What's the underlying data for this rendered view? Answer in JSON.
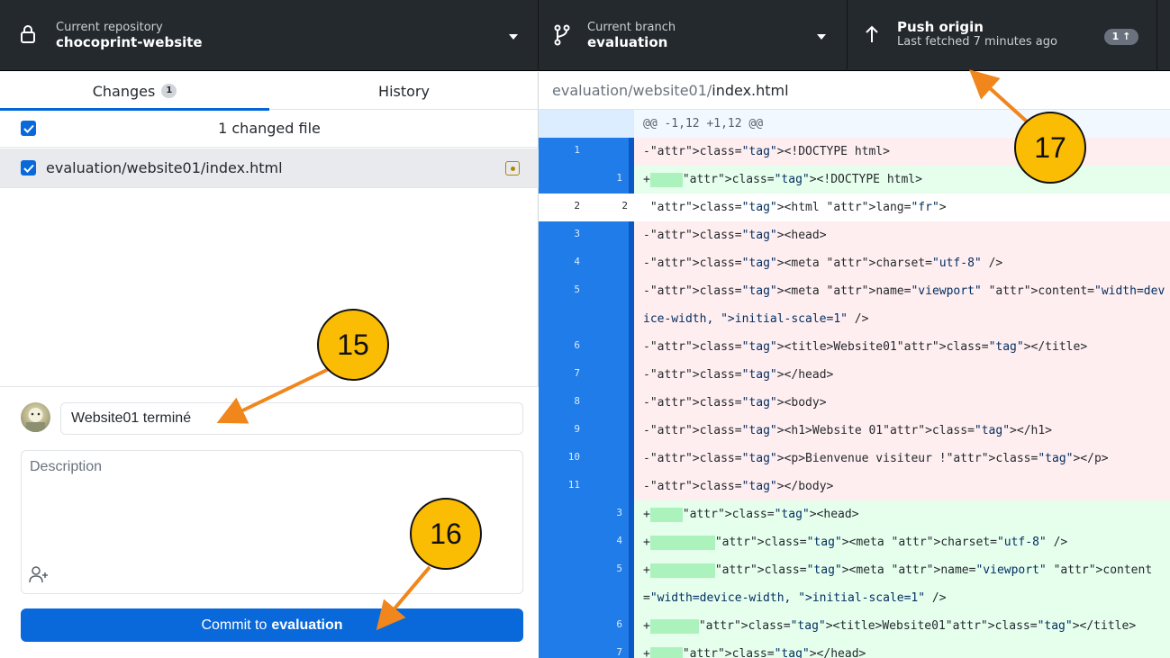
{
  "toolbar": {
    "repository": {
      "label": "Current repository",
      "value": "chocoprint-website"
    },
    "branch": {
      "label": "Current branch",
      "value": "evaluation"
    },
    "push": {
      "label": "Push origin",
      "sub": "Last fetched 7 minutes ago",
      "badge": "1 ↑"
    }
  },
  "tabs": [
    {
      "label": "Changes",
      "count": "1"
    },
    {
      "label": "History"
    }
  ],
  "changes": {
    "summary": "1 changed file",
    "files": [
      {
        "path": "evaluation/website01/index.html",
        "status_icon": "modified-icon"
      }
    ]
  },
  "commit": {
    "summary_value": "Website01 terminé",
    "description_placeholder": "Description",
    "button_prefix": "Commit to",
    "button_branch": "evaluation"
  },
  "diff": {
    "path_prefix": "evaluation/website01/",
    "file_name": "index.html",
    "hunk": "@@ -1,12 +1,12 @@",
    "lines": [
      {
        "type": "del",
        "old": "1",
        "new": "",
        "text": "-<!DOCTYPE html>"
      },
      {
        "type": "add",
        "old": "",
        "new": "1",
        "text": "+    <!DOCTYPE html>"
      },
      {
        "type": "ctx",
        "old": "2",
        "new": "2",
        "text": " <html lang=\"fr\">"
      },
      {
        "type": "del",
        "old": "3",
        "new": "",
        "text": "-<head>"
      },
      {
        "type": "del",
        "old": "4",
        "new": "",
        "text": "-<meta charset=\"utf-8\" />"
      },
      {
        "type": "del",
        "old": "5",
        "new": "",
        "text": "-<meta name=\"viewport\" content=\"width=device-width, initial-scale=1\" />"
      },
      {
        "type": "del",
        "old": "6",
        "new": "",
        "text": "-<title>Website01</title>"
      },
      {
        "type": "del",
        "old": "7",
        "new": "",
        "text": "-</head>"
      },
      {
        "type": "del",
        "old": "8",
        "new": "",
        "text": "-<body>"
      },
      {
        "type": "del",
        "old": "9",
        "new": "",
        "text": "-<h1>Website 01</h1>"
      },
      {
        "type": "del",
        "old": "10",
        "new": "",
        "text": "-<p>Bienvenue visiteur !</p>"
      },
      {
        "type": "del",
        "old": "11",
        "new": "",
        "text": "-</body>"
      },
      {
        "type": "add",
        "old": "",
        "new": "3",
        "text": "+    <head>"
      },
      {
        "type": "add",
        "old": "",
        "new": "4",
        "text": "+        <meta charset=\"utf-8\" />"
      },
      {
        "type": "add",
        "old": "",
        "new": "5",
        "text": "+        <meta name=\"viewport\" content=\"width=device-width, initial-scale=1\" />"
      },
      {
        "type": "add",
        "old": "",
        "new": "6",
        "text": "+      <title>Website01</title>"
      },
      {
        "type": "add",
        "old": "",
        "new": "7",
        "text": "+    </head>"
      }
    ]
  },
  "annotations": [
    {
      "label": "15"
    },
    {
      "label": "16"
    },
    {
      "label": "17"
    }
  ],
  "colors": {
    "toolbar_bg": "#24292e",
    "accent": "#0969da",
    "callout": "#fbbc04",
    "arrow": "#f0861c",
    "deleted_bg": "#ffeef0",
    "added_bg": "#e6ffed"
  }
}
